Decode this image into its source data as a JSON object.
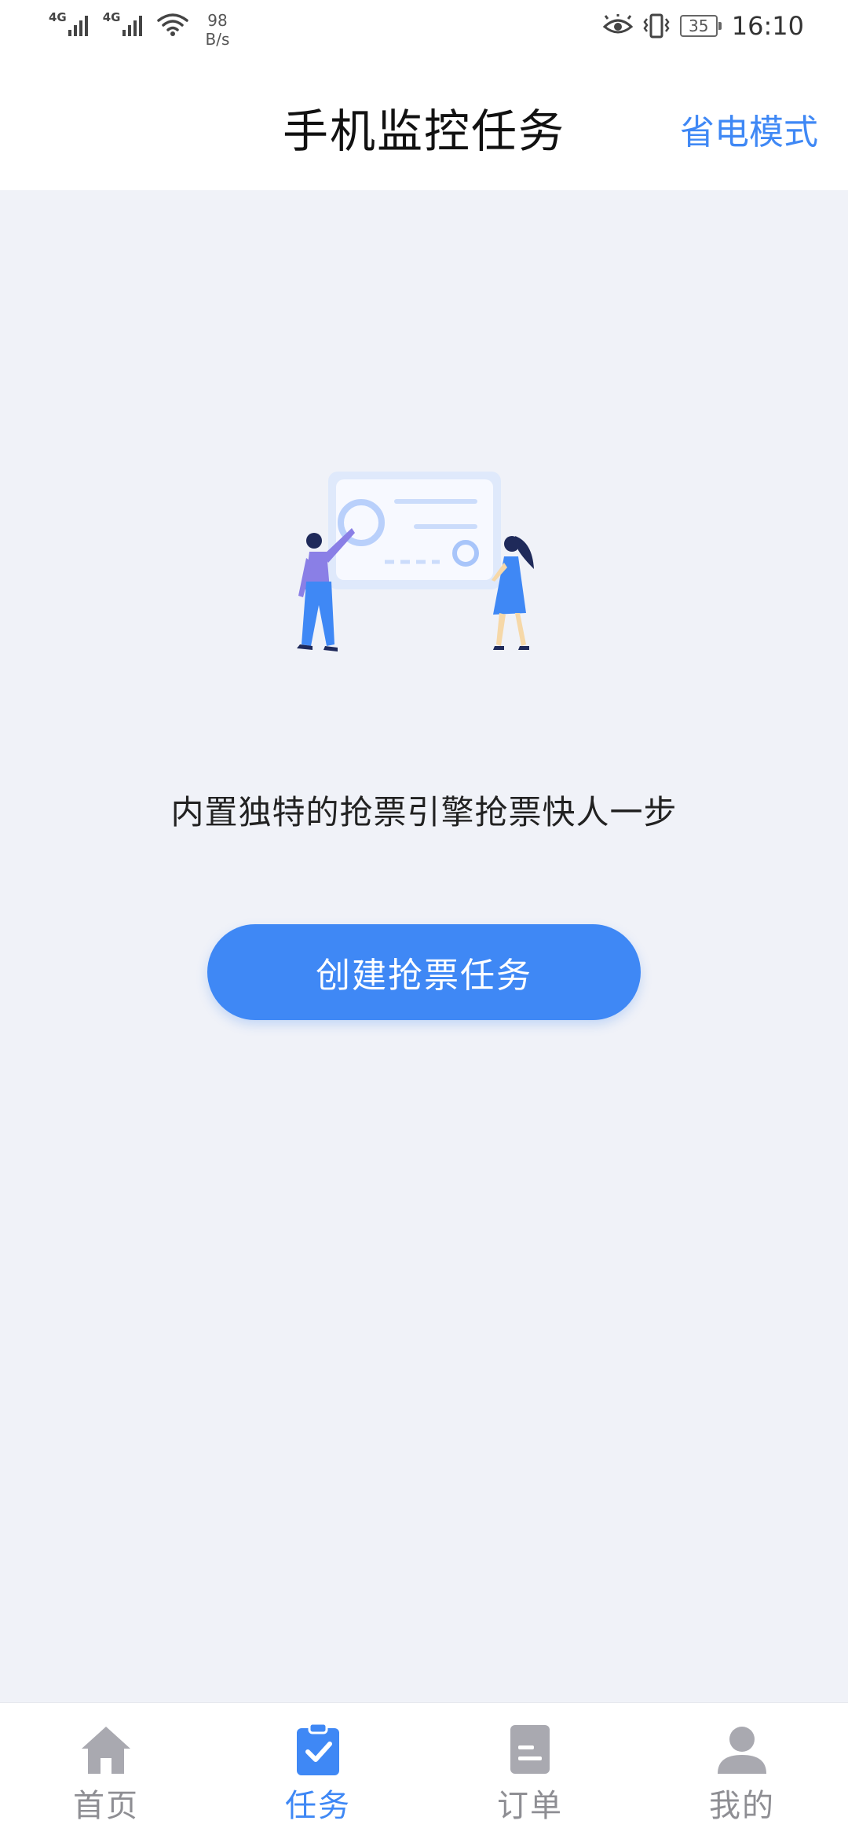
{
  "status_bar": {
    "net1": "4G",
    "net2": "4G",
    "speed_value": "98",
    "speed_unit": "B/s",
    "battery": "35",
    "time": "16:10"
  },
  "header": {
    "title": "手机监控任务",
    "power_save": "省电模式"
  },
  "main": {
    "tagline": "内置独特的抢票引擎抢票快人一步",
    "create_button": "创建抢票任务"
  },
  "bottom_nav": {
    "items": [
      {
        "label": "首页",
        "icon": "home-icon",
        "active": false
      },
      {
        "label": "任务",
        "icon": "task-clipboard-icon",
        "active": true
      },
      {
        "label": "订单",
        "icon": "order-document-icon",
        "active": false
      },
      {
        "label": "我的",
        "icon": "profile-person-icon",
        "active": false
      }
    ]
  },
  "colors": {
    "accent": "#3f88f5",
    "background": "#f0f2f8",
    "inactive": "#8e8e93"
  }
}
